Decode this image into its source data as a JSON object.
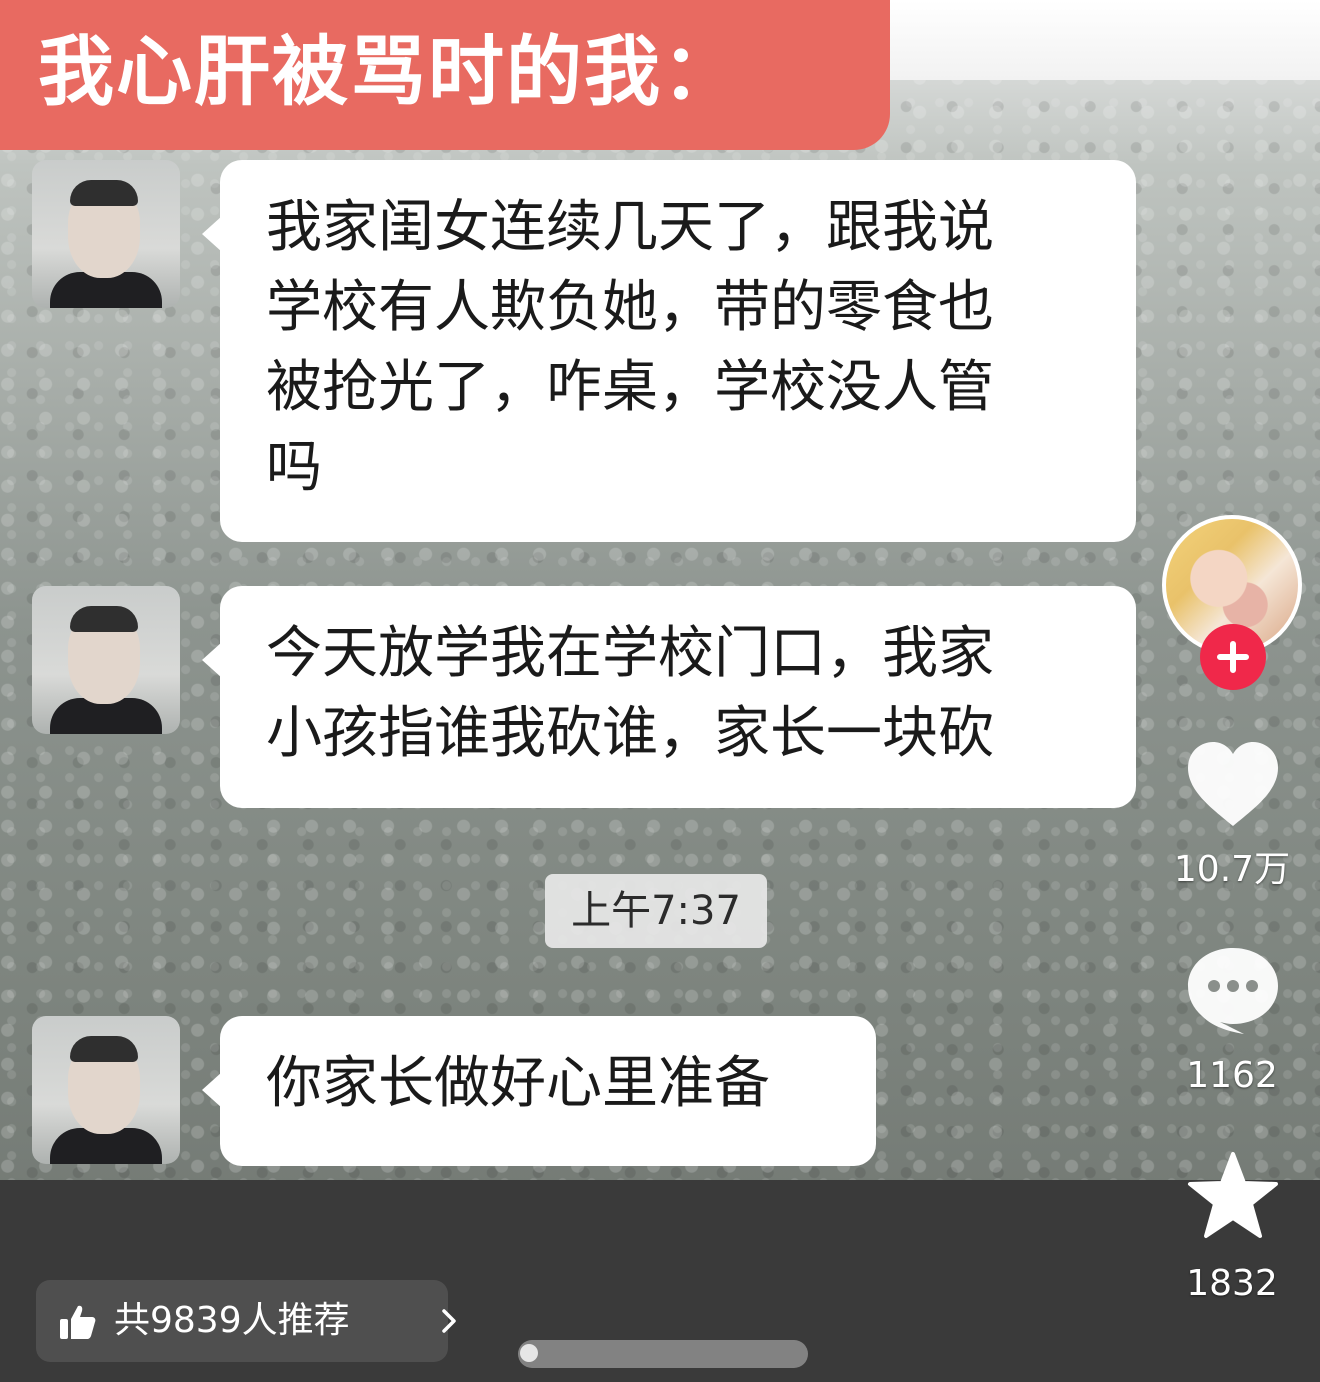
{
  "banner": {
    "title": "我心肝被骂时的我："
  },
  "messages": [
    {
      "lines": [
        "我家闺女连续几天了，跟我说",
        "学校有人欺负她，带的零食也",
        "被抢光了，咋桌，学校没人管",
        "吗"
      ]
    },
    {
      "lines": [
        "今天放学我在学校门口，我家",
        "小孩指谁我砍谁，家长一块砍"
      ]
    },
    {
      "lines": [
        "你家长做好心里准备"
      ]
    }
  ],
  "timestamp": "上午7:37",
  "sidebar": {
    "likes": "10.7万",
    "comments": "1162",
    "favorites": "1832"
  },
  "recommend": {
    "label": "共9839人推荐"
  },
  "colors": {
    "banner": "#e86a61",
    "follow": "#f0284a",
    "bottom_bar": "#3a3a3a"
  }
}
